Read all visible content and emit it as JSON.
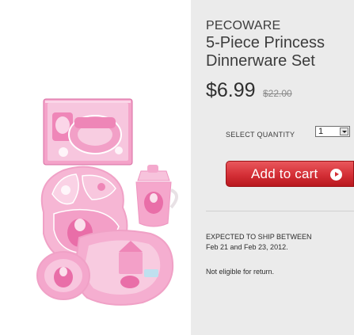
{
  "product": {
    "brand": "PECOWARE",
    "title": "5-Piece Princess Dinnerware Set",
    "price": "$6.99",
    "original_price": "$22.00",
    "image_icon": "princess-dinnerware-set-image"
  },
  "quantity": {
    "label": "SELECT QUANTITY",
    "value": "1",
    "arrow_icon": "chevron-down-icon"
  },
  "cart": {
    "button_label": "Add to cart",
    "arrow_icon": "arrow-right-circle-icon"
  },
  "shipping": {
    "heading": "EXPECTED TO SHIP BETWEEN",
    "dates": "Feb 21 and Feb 23, 2012."
  },
  "returns": {
    "note": "Not eligible for return."
  },
  "colors": {
    "panel_background": "#ebebeb",
    "button_red": "#d42f36",
    "product_pink": "#f3a9cc"
  }
}
